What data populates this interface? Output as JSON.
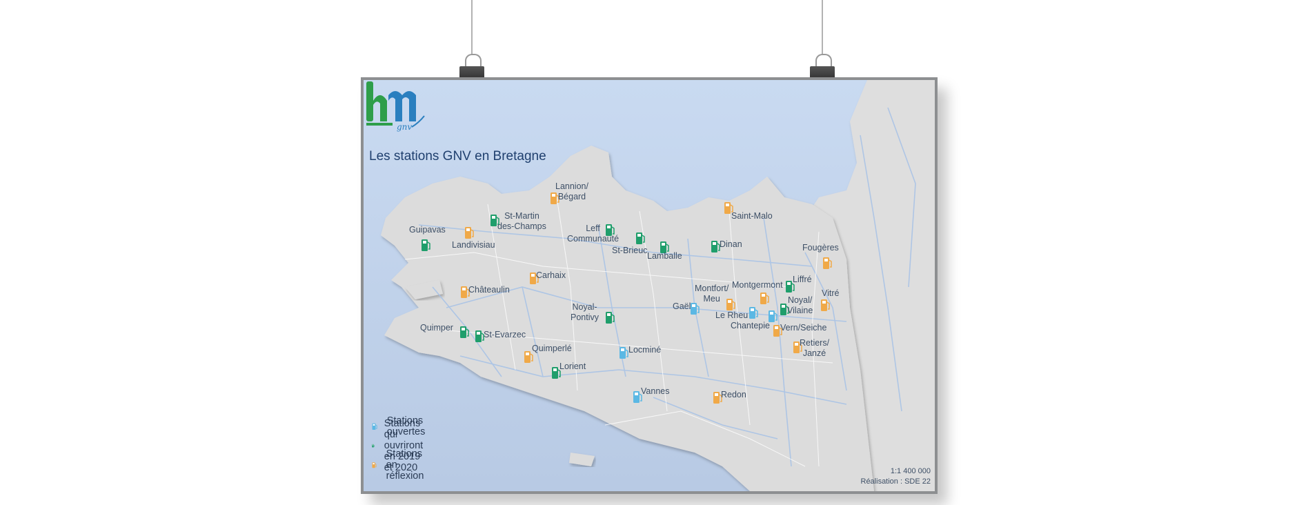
{
  "title": "Les stations GNV en Bretagne",
  "logo": {
    "letters": "bm",
    "sub": "gnv"
  },
  "colors": {
    "open": "#5bb8e4",
    "future": "#1f9e6b",
    "reflection": "#f0a948",
    "sea": "#c5d6ee",
    "land": "#dcdcdc",
    "roads": "#a9c3e6"
  },
  "legend": {
    "open": "Stations ouvertes",
    "future": "Stations qui ouvriront en 2019 et 2020",
    "reflection": "Stations en réflexion"
  },
  "scale": "1:1 400 000",
  "credit": "Réalisation : SDE 22",
  "places": [
    {
      "name": "Guipavas",
      "status": "future"
    },
    {
      "name": "Landivisiau",
      "status": "reflection"
    },
    {
      "name": "St-Martin\ndes-Champs",
      "status": "future"
    },
    {
      "name": "Lannion/\nBégard",
      "status": "reflection"
    },
    {
      "name": "Leff\nCommunauté",
      "status": "future"
    },
    {
      "name": "St-Brieuc",
      "status": "future"
    },
    {
      "name": "Lamballe",
      "status": "future"
    },
    {
      "name": "Dinan",
      "status": "future"
    },
    {
      "name": "Saint-Malo",
      "status": "reflection"
    },
    {
      "name": "Fougères",
      "status": "reflection"
    },
    {
      "name": "Carhaix",
      "status": "reflection"
    },
    {
      "name": "Châteaulin",
      "status": "reflection"
    },
    {
      "name": "Montfort/\nMeu",
      "status": "reflection"
    },
    {
      "name": "Montgermont",
      "status": "reflection"
    },
    {
      "name": "Liffré",
      "status": "future"
    },
    {
      "name": "Vitré",
      "status": "reflection"
    },
    {
      "name": "Gaël",
      "status": "open"
    },
    {
      "name": "Le Rheu",
      "status": "open"
    },
    {
      "name": "Chantepie",
      "status": "open"
    },
    {
      "name": "Noyal/\nVilaine",
      "status": "future"
    },
    {
      "name": "Noyal-\nPontivy",
      "status": "future"
    },
    {
      "name": "Vern/Seiche",
      "status": "reflection"
    },
    {
      "name": "Quimper",
      "status": "future"
    },
    {
      "name": "St-Evarzec",
      "status": "future"
    },
    {
      "name": "Quimperlé",
      "status": "reflection"
    },
    {
      "name": "Retiers/\nJanzé",
      "status": "reflection"
    },
    {
      "name": "Locminé",
      "status": "open"
    },
    {
      "name": "Lorient",
      "status": "future"
    },
    {
      "name": "Vannes",
      "status": "open"
    },
    {
      "name": "Redon",
      "status": "reflection"
    }
  ]
}
